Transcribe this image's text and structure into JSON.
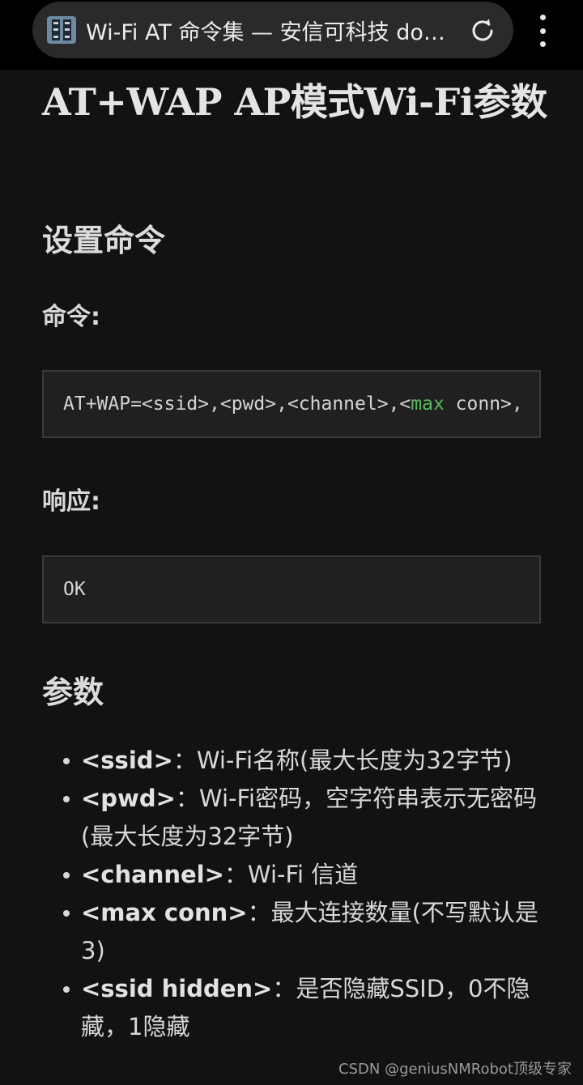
{
  "browser": {
    "tab_title": "Wi-Fi AT 命令集 — 安信可科技 do…",
    "site_icon": "docs-site-icon",
    "reload_icon": "reload-icon",
    "menu_icon": "more-vert-icon"
  },
  "page": {
    "title": "AT+WAP AP模式Wi-Fi参数",
    "set_command_heading": "设置命令",
    "command_label": "命令:",
    "command_text": "AT+WAP=<ssid>,<pwd>,<channel>,<",
    "command_keyword": "max",
    "command_rest": " conn>,",
    "response_label": "响应:",
    "response_text": "OK",
    "params_heading": "参数",
    "params": [
      {
        "name": "<ssid>",
        "desc": "：Wi-Fi名称(最大长度为32字节)"
      },
      {
        "name": "<pwd>",
        "desc": "：Wi-Fi密码，空字符串表示无密码(最大长度为32字节)"
      },
      {
        "name": "<channel>",
        "desc": "：Wi-Fi 信道"
      },
      {
        "name": "<max conn>",
        "desc": "：最大连接数量(不写默认是3)"
      },
      {
        "name": "<ssid hidden>",
        "desc": "：是否隐藏SSID，0不隐藏，1隐藏"
      }
    ]
  },
  "watermark": "CSDN @geniusNMRobot顶级专家",
  "colors": {
    "background": "#121212",
    "code_keyword": "#5cb85c",
    "code_background": "#202020"
  }
}
